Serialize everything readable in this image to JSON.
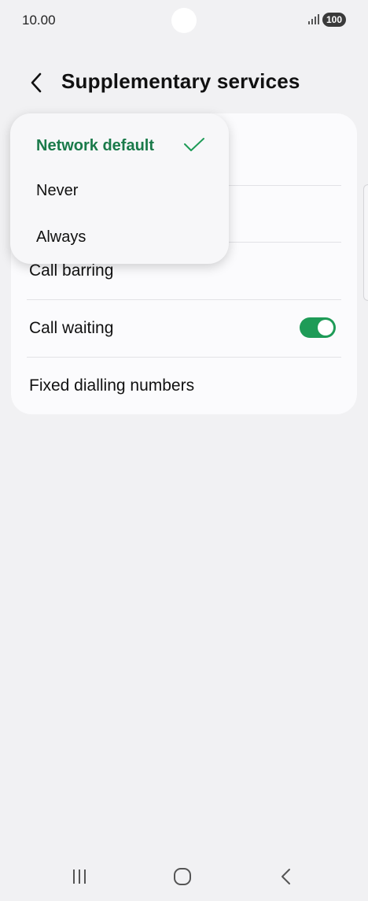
{
  "status_bar": {
    "time": "10.00",
    "battery": "100"
  },
  "header": {
    "title": "Supplementary services"
  },
  "popup": {
    "items": [
      {
        "label": "Network default",
        "selected": true
      },
      {
        "label": "Never",
        "selected": false
      },
      {
        "label": "Always",
        "selected": false
      }
    ]
  },
  "list": {
    "rows": [
      {
        "label": "Call barring"
      },
      {
        "label": "Call waiting",
        "toggle_on": true
      },
      {
        "label": "Fixed dialling numbers"
      }
    ]
  },
  "colors": {
    "accent": "#1e9b57",
    "selected_text": "#1a7a4a"
  },
  "icons": [
    "back-arrow-icon",
    "check-icon",
    "signal-icon",
    "battery-icon",
    "recent-apps-icon",
    "home-icon",
    "nav-back-icon"
  ]
}
